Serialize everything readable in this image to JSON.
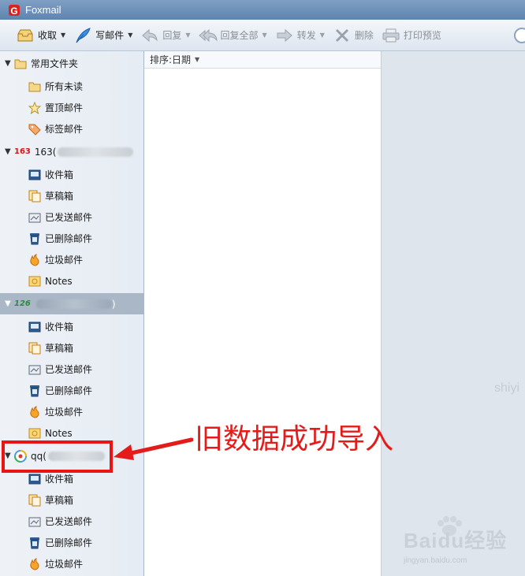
{
  "window": {
    "title": "Foxmail"
  },
  "toolbar": {
    "receive": "收取",
    "compose": "写邮件",
    "reply": "回复",
    "reply_all": "回复全部",
    "forward": "转发",
    "delete": "删除",
    "print_preview": "打印预览"
  },
  "sidebar": {
    "common": {
      "label": "常用文件夹",
      "items": [
        "所有未读",
        "置顶邮件",
        "标签邮件"
      ]
    },
    "account163": {
      "badge": "163",
      "label": "163(",
      "items": [
        "收件箱",
        "草稿箱",
        "已发送邮件",
        "已删除邮件",
        "垃圾邮件",
        "Notes"
      ]
    },
    "account126": {
      "badge": "126",
      "label": ")",
      "items": [
        "收件箱",
        "草稿箱",
        "已发送邮件",
        "已删除邮件",
        "垃圾邮件",
        "Notes"
      ]
    },
    "accountqq": {
      "label": "qq(",
      "items": [
        "收件箱",
        "草稿箱",
        "已发送邮件",
        "已删除邮件",
        "垃圾邮件"
      ]
    }
  },
  "message_list": {
    "sort_label": "排序:日期"
  },
  "annotation": {
    "text": "旧数据成功导入"
  },
  "watermark": {
    "site": "shiyi",
    "brand": "Baidu经验",
    "url": "jingyan.baidu.com"
  },
  "colors": {
    "annotation_red": "#e41b1b",
    "titlebar": "#6f92bb",
    "sidebar_bg": "#eaeff5"
  }
}
